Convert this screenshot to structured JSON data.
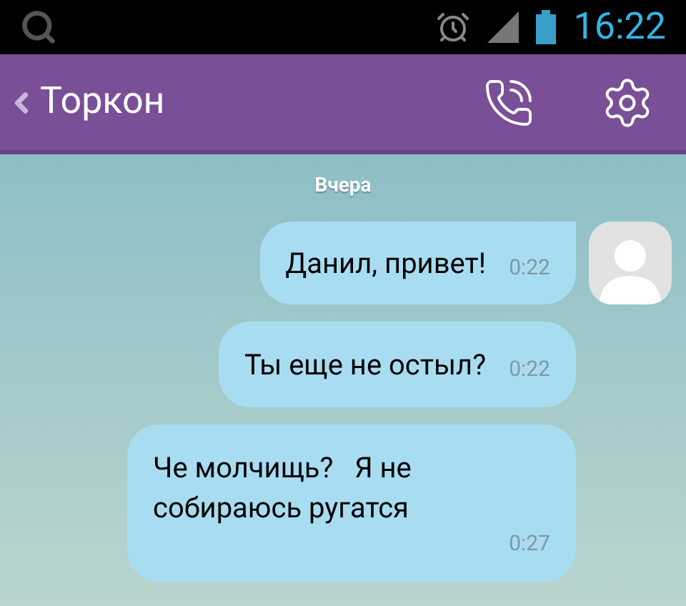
{
  "status_bar": {
    "time": "16:22"
  },
  "header": {
    "title": "Торкон"
  },
  "date_label": "Вчера",
  "messages": [
    {
      "text": "Данил, привет!",
      "time": "0:22",
      "avatar": true
    },
    {
      "text": "Ты еще не остыл?",
      "time": "0:22",
      "avatar": false
    },
    {
      "text": "Че молчищь?   Я не собираюсь ругатся",
      "time": "0:27",
      "avatar": false
    }
  ]
}
